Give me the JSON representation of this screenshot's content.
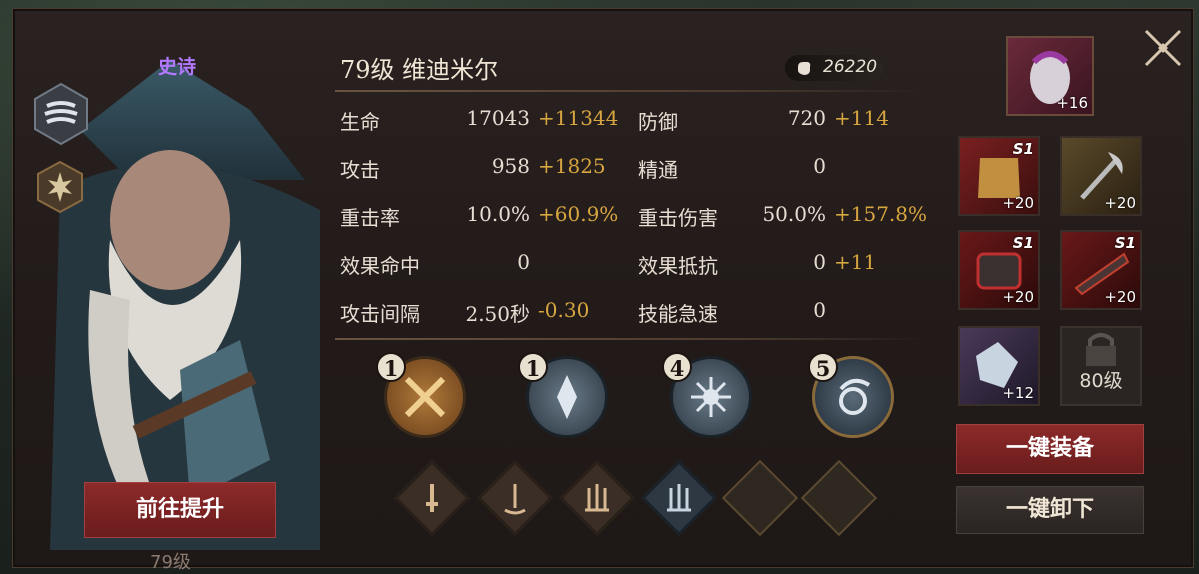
{
  "hero": {
    "rarity": "史诗",
    "title": "79级  维迪米尔",
    "power": "26220"
  },
  "stats": [
    {
      "label": "生命",
      "base": "17043",
      "bonus": "+11344"
    },
    {
      "label": "防御",
      "base": "720",
      "bonus": "+114"
    },
    {
      "label": "攻击",
      "base": "958",
      "bonus": "+1825"
    },
    {
      "label": "精通",
      "base": "0",
      "bonus": ""
    },
    {
      "label": "重击率",
      "base": "10.0%",
      "bonus": "+60.9%"
    },
    {
      "label": "重击伤害",
      "base": "50.0%",
      "bonus": "+157.8%"
    },
    {
      "label": "效果命中",
      "base": "0",
      "bonus": ""
    },
    {
      "label": "效果抵抗",
      "base": "0",
      "bonus": "+11"
    },
    {
      "label": "攻击间隔",
      "base": "2.50秒",
      "bonus": "-0.30"
    },
    {
      "label": "技能急速",
      "base": "0",
      "bonus": ""
    }
  ],
  "skills": [
    {
      "level": "1",
      "icon": "crossed-swords-icon",
      "color": "#8a5a2a"
    },
    {
      "level": "1",
      "icon": "shard-icon",
      "color": "#3a4a55"
    },
    {
      "level": "4",
      "icon": "burst-icon",
      "color": "#3a4a55"
    },
    {
      "level": "5",
      "icon": "orb-icon",
      "color": "#2f3e4a"
    }
  ],
  "equipment": [
    {
      "name": "mask",
      "level": "+16",
      "tag": ""
    },
    {
      "name": "armor",
      "level": "+20",
      "tag": "S1"
    },
    {
      "name": "axe",
      "level": "+20",
      "tag": ""
    },
    {
      "name": "gauntlet",
      "level": "+20",
      "tag": "S1"
    },
    {
      "name": "bracer",
      "level": "+20",
      "tag": "S1"
    },
    {
      "name": "gem",
      "level": "+12",
      "tag": ""
    },
    {
      "name": "locked-slot",
      "level": "80级",
      "tag": ""
    }
  ],
  "buttons": {
    "upgrade": "前往提升",
    "equip_all": "一键装备",
    "unequip_all": "一键卸下"
  },
  "footer_text": "79级"
}
